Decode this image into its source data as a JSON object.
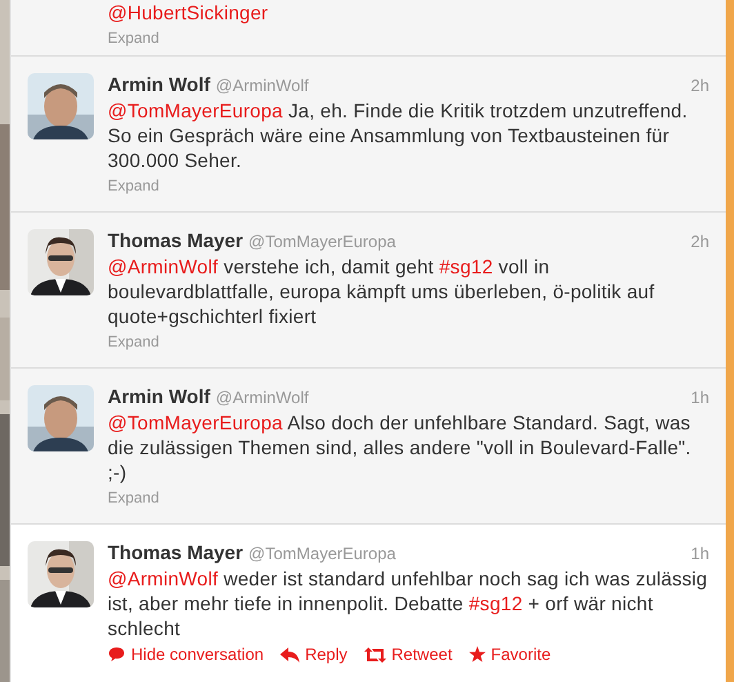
{
  "tweets": [
    {
      "partial": true,
      "body": [
        {
          "kind": "mention",
          "text": "@HubertSickinger"
        }
      ],
      "footer": "Expand",
      "expanded": false
    },
    {
      "partial": false,
      "name": "Armin Wolf",
      "handle": "@ArminWolf",
      "time": "2h",
      "body": [
        {
          "kind": "mention",
          "text": "@TomMayerEuropa"
        },
        {
          "kind": "plain",
          "text": " Ja, eh. Finde die Kritik trotzdem unzutreffend. So ein Gespräch wäre eine Ansammlung von Textbausteinen für 300.000 Seher."
        }
      ],
      "footer": "Expand",
      "expanded": false
    },
    {
      "partial": false,
      "name": "Thomas Mayer",
      "handle": "@TomMayerEuropa",
      "time": "2h",
      "body": [
        {
          "kind": "mention",
          "text": "@ArminWolf"
        },
        {
          "kind": "plain",
          "text": " verstehe ich, damit geht "
        },
        {
          "kind": "hashtag",
          "text": "#sg12"
        },
        {
          "kind": "plain",
          "text": " voll in boulevardblattfalle, europa kämpft ums überleben, ö-politik auf quote+gschichterl fixiert"
        }
      ],
      "footer": "Expand",
      "expanded": false
    },
    {
      "partial": false,
      "name": "Armin Wolf",
      "handle": "@ArminWolf",
      "time": "1h",
      "body": [
        {
          "kind": "mention",
          "text": "@TomMayerEuropa"
        },
        {
          "kind": "plain",
          "text": " Also doch der unfehlbare Standard. Sagt, was die zulässigen Themen sind, alles andere \"voll in Boulevard-Falle\". ;-)"
        }
      ],
      "footer": "Expand",
      "expanded": false
    },
    {
      "partial": false,
      "name": "Thomas Mayer",
      "handle": "@TomMayerEuropa",
      "time": "1h",
      "body": [
        {
          "kind": "mention",
          "text": "@ArminWolf"
        },
        {
          "kind": "plain",
          "text": " weder ist standard unfehlbar noch sag ich was zulässig ist, aber mehr tiefe in innenpolit. Debatte "
        },
        {
          "kind": "hashtag",
          "text": "#sg12"
        },
        {
          "kind": "plain",
          "text": " + orf wär nicht schlecht"
        }
      ],
      "expanded": true,
      "actions": [
        {
          "kind": "conversation",
          "label": "Hide conversation"
        },
        {
          "kind": "reply",
          "label": "Reply"
        },
        {
          "kind": "retweet",
          "label": "Retweet"
        },
        {
          "kind": "favorite",
          "label": "Favorite"
        }
      ]
    }
  ]
}
